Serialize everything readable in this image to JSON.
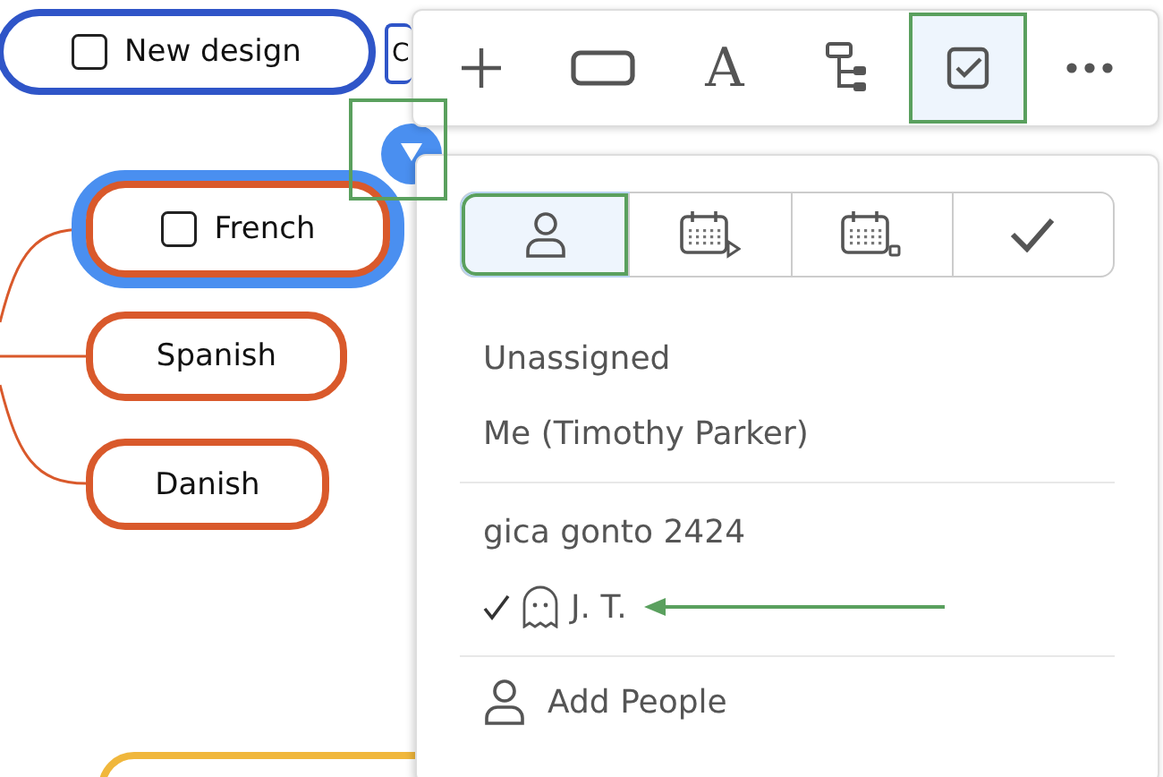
{
  "canvas": {
    "nodes": [
      {
        "label": "New design",
        "checked": false,
        "selected": false,
        "color": "#2f55c8"
      },
      {
        "label": "C",
        "selected": false,
        "color": "#2f55c8"
      },
      {
        "label": "French",
        "checked": false,
        "selected": true,
        "color": "#d9592b"
      },
      {
        "label": "Spanish",
        "selected": false,
        "color": "#d9592b"
      },
      {
        "label": "Danish",
        "selected": false,
        "color": "#d9592b"
      },
      {
        "selected": false,
        "color": "#f0b73c"
      }
    ],
    "collapse_handle": {
      "highlighted": true
    }
  },
  "toolbar": {
    "tools": [
      {
        "kind": "add",
        "selected": false,
        "highlighted": false
      },
      {
        "kind": "shape",
        "selected": false,
        "highlighted": false
      },
      {
        "kind": "text",
        "label": "A",
        "selected": false,
        "highlighted": false
      },
      {
        "kind": "layout",
        "selected": false,
        "highlighted": false
      },
      {
        "kind": "task",
        "selected": true,
        "highlighted": true
      },
      {
        "kind": "more",
        "selected": false,
        "highlighted": false
      }
    ]
  },
  "assign_popup": {
    "tabs": [
      {
        "kind": "assignee",
        "selected": true,
        "highlighted": true
      },
      {
        "kind": "start-date",
        "selected": false,
        "highlighted": false
      },
      {
        "kind": "due-date",
        "selected": false,
        "highlighted": false
      },
      {
        "kind": "complete",
        "selected": false,
        "highlighted": false
      }
    ],
    "groups": [
      [
        {
          "label": "Unassigned",
          "selected": false,
          "guest": false,
          "pointed": false
        },
        {
          "label": "Me (Timothy Parker)",
          "selected": false,
          "guest": false,
          "pointed": false
        }
      ],
      [
        {
          "label": "gica gonto 2424",
          "selected": false,
          "guest": false,
          "pointed": false
        },
        {
          "label": "J. T.",
          "selected": true,
          "guest": true,
          "pointed": true
        }
      ]
    ],
    "add_action": {
      "label": "Add People"
    }
  }
}
